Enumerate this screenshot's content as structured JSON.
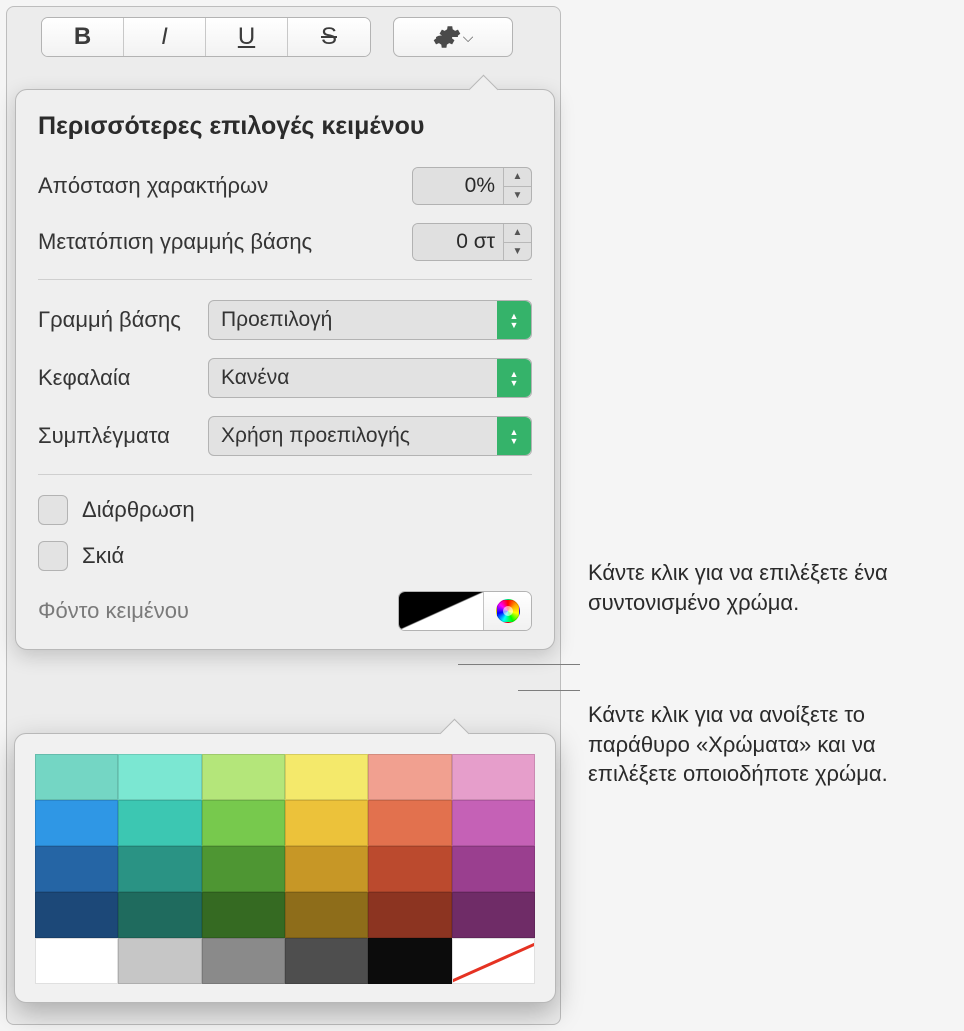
{
  "toolbar": {
    "bold": "B",
    "italic": "I",
    "underline": "U",
    "strike": "S"
  },
  "panel": {
    "title": "Περισσότερες επιλογές κειμένου",
    "charSpacingLabel": "Απόσταση χαρακτήρων",
    "charSpacingValue": "0%",
    "baselineShiftLabel": "Μετατόπιση γραμμής βάσης",
    "baselineShiftValue": "0 στ",
    "baselineLabel": "Γραμμή βάσης",
    "baselineValue": "Προεπιλογή",
    "capsLabel": "Κεφαλαία",
    "capsValue": "Κανένα",
    "ligLabel": "Συμπλέγματα",
    "ligValue": "Χρήση προεπιλογής",
    "outlineLabel": "Διάρθρωση",
    "shadowLabel": "Σκιά",
    "textBgLabel": "Φόντο κειμένου"
  },
  "palette": {
    "rows": [
      [
        "#74d6c4",
        "#7be7d2",
        "#b4e67a",
        "#f4e96b",
        "#f1a090",
        "#e69ecb"
      ],
      [
        "#2f97e5",
        "#3cc7b2",
        "#77c94d",
        "#ecc23a",
        "#e2714e",
        "#c561b6"
      ],
      [
        "#2565a5",
        "#2a9384",
        "#4e9633",
        "#c79726",
        "#bb4a2e",
        "#9a3f8f"
      ],
      [
        "#1c4878",
        "#1f6b5e",
        "#356a22",
        "#8e6d1a",
        "#8c3421",
        "#6f2c67"
      ]
    ],
    "lastRow": [
      "#ffffff",
      "#c6c6c6",
      "#8a8a8a",
      "#4e4e4e",
      "#0c0c0c",
      "none"
    ]
  },
  "callouts": {
    "swatch": "Κάντε κλικ για να επιλέξετε ένα συντονισμένο χρώμα.",
    "wheel": "Κάντε κλικ για να ανοίξετε το παράθυρο «Χρώματα» και να επιλέξετε οποιοδήποτε χρώμα."
  }
}
